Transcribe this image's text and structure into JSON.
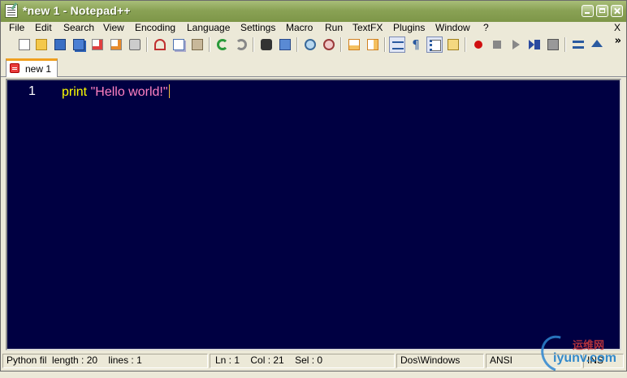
{
  "window": {
    "title": "*new  1 - Notepad++"
  },
  "menu": {
    "items": [
      "File",
      "Edit",
      "Search",
      "View",
      "Encoding",
      "Language",
      "Settings",
      "Macro",
      "Run",
      "TextFX",
      "Plugins",
      "Window",
      "?"
    ],
    "close_label": "X"
  },
  "toolbar": {
    "buttons": [
      "new-file",
      "open-file",
      "save",
      "save-all",
      "close",
      "close-all",
      "print",
      "cut",
      "copy",
      "paste",
      "undo",
      "redo",
      "find",
      "replace",
      "zoom-in",
      "zoom-out",
      "sync-vertical",
      "sync-horizontal",
      "word-wrap",
      "show-all-chars",
      "indent-guide",
      "user-lang",
      "record-macro",
      "stop-record",
      "play-macro",
      "run-macro-multiple",
      "save-macro",
      "fold",
      "unfold"
    ],
    "overflow": "»"
  },
  "tabs": [
    {
      "label": "new  1",
      "active": true
    }
  ],
  "editor": {
    "line_number": "1",
    "keyword": "print",
    "space": " ",
    "string": "\"Hello world!\"",
    "background": "#000042",
    "keyword_color": "#ffff00",
    "string_color": "#ff80c0"
  },
  "status": {
    "filetype": "Python fil",
    "length": "length : 20",
    "lines": "lines : 1",
    "ln": "Ln : 1",
    "col": "Col : 21",
    "sel": "Sel : 0",
    "eol": "Dos\\Windows",
    "encoding": "ANSI",
    "mode": "INS"
  },
  "watermark": {
    "brand_cn": "运维网",
    "brand_en": "iyunv.com"
  }
}
